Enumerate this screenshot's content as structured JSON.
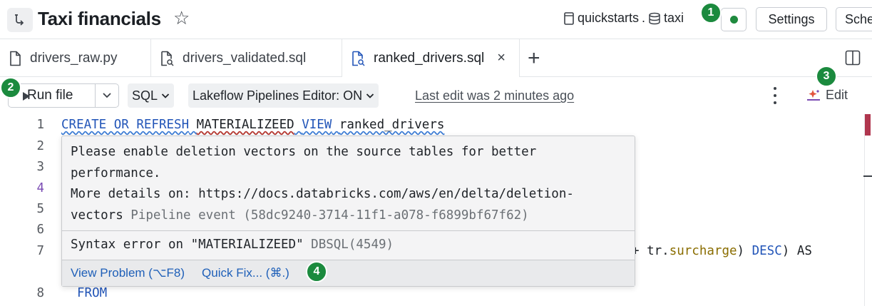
{
  "header": {
    "title": "Taxi financials",
    "catalog": "quickstarts",
    "separator": ".",
    "schema": "taxi",
    "settings_label": "Settings",
    "schedule_label": "Sche"
  },
  "tabs": [
    {
      "label": "drivers_raw.py",
      "icon": "file-icon"
    },
    {
      "label": "drivers_validated.sql",
      "icon": "sql-file-icon"
    },
    {
      "label": "ranked_drivers.sql",
      "icon": "sql-file-icon",
      "active": true,
      "close": "×"
    }
  ],
  "toolbar": {
    "run_label": "Run file",
    "language": "SQL",
    "editor_mode": "Lakeflow Pipelines Editor: ON",
    "last_edit": "Last edit was 2 minutes ago",
    "edit_label": "Edit"
  },
  "editor": {
    "line_numbers": [
      "1",
      "2",
      "3",
      "4",
      "5",
      "6",
      "7",
      "8"
    ],
    "line1": {
      "kw1": "CREATE OR REFRESH",
      "err": "MATERIALIZEED",
      "kw2": "VIEW",
      "name": "ranked_drivers"
    },
    "line7": {
      "pre": "tr.",
      "field": "surcharge",
      "post": ") ",
      "kw": "DESC",
      "tail": ") AS",
      "lead": "+ "
    },
    "line8": {
      "kw": "FROM"
    }
  },
  "hover": {
    "msg_line1": "Please enable deletion vectors on the source tables for better",
    "msg_line2": "performance.",
    "msg_line3": "More details on: https://docs.databricks.com/aws/en/delta/deletion-",
    "msg_line4_a": "vectors",
    "msg_line4_b": " Pipeline event (58dc9240-3714-11f1-a078-f6899bf67f62)",
    "error_a": "Syntax error on \"MATERIALIZEED\"",
    "error_b": " DBSQL(4549)",
    "view_problem": "View Problem (⌥F8)",
    "quick_fix": "Quick Fix... (⌘.)"
  },
  "badges": [
    "1",
    "2",
    "3",
    "4"
  ],
  "colors": {
    "accent_green": "#1b8a3e",
    "keyword_blue": "#2255b8",
    "link_blue": "#1e5fb8"
  }
}
